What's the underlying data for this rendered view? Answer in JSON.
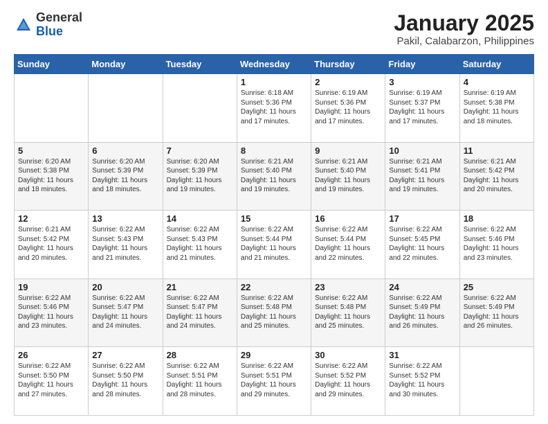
{
  "header": {
    "logo_general": "General",
    "logo_blue": "Blue",
    "title": "January 2025",
    "subtitle": "Pakil, Calabarzon, Philippines"
  },
  "weekdays": [
    "Sunday",
    "Monday",
    "Tuesday",
    "Wednesday",
    "Thursday",
    "Friday",
    "Saturday"
  ],
  "weeks": [
    [
      {
        "day": "",
        "info": ""
      },
      {
        "day": "",
        "info": ""
      },
      {
        "day": "",
        "info": ""
      },
      {
        "day": "1",
        "info": "Sunrise: 6:18 AM\nSunset: 5:36 PM\nDaylight: 11 hours\nand 17 minutes."
      },
      {
        "day": "2",
        "info": "Sunrise: 6:19 AM\nSunset: 5:36 PM\nDaylight: 11 hours\nand 17 minutes."
      },
      {
        "day": "3",
        "info": "Sunrise: 6:19 AM\nSunset: 5:37 PM\nDaylight: 11 hours\nand 17 minutes."
      },
      {
        "day": "4",
        "info": "Sunrise: 6:19 AM\nSunset: 5:38 PM\nDaylight: 11 hours\nand 18 minutes."
      }
    ],
    [
      {
        "day": "5",
        "info": "Sunrise: 6:20 AM\nSunset: 5:38 PM\nDaylight: 11 hours\nand 18 minutes."
      },
      {
        "day": "6",
        "info": "Sunrise: 6:20 AM\nSunset: 5:39 PM\nDaylight: 11 hours\nand 18 minutes."
      },
      {
        "day": "7",
        "info": "Sunrise: 6:20 AM\nSunset: 5:39 PM\nDaylight: 11 hours\nand 19 minutes."
      },
      {
        "day": "8",
        "info": "Sunrise: 6:21 AM\nSunset: 5:40 PM\nDaylight: 11 hours\nand 19 minutes."
      },
      {
        "day": "9",
        "info": "Sunrise: 6:21 AM\nSunset: 5:40 PM\nDaylight: 11 hours\nand 19 minutes."
      },
      {
        "day": "10",
        "info": "Sunrise: 6:21 AM\nSunset: 5:41 PM\nDaylight: 11 hours\nand 19 minutes."
      },
      {
        "day": "11",
        "info": "Sunrise: 6:21 AM\nSunset: 5:42 PM\nDaylight: 11 hours\nand 20 minutes."
      }
    ],
    [
      {
        "day": "12",
        "info": "Sunrise: 6:21 AM\nSunset: 5:42 PM\nDaylight: 11 hours\nand 20 minutes."
      },
      {
        "day": "13",
        "info": "Sunrise: 6:22 AM\nSunset: 5:43 PM\nDaylight: 11 hours\nand 21 minutes."
      },
      {
        "day": "14",
        "info": "Sunrise: 6:22 AM\nSunset: 5:43 PM\nDaylight: 11 hours\nand 21 minutes."
      },
      {
        "day": "15",
        "info": "Sunrise: 6:22 AM\nSunset: 5:44 PM\nDaylight: 11 hours\nand 21 minutes."
      },
      {
        "day": "16",
        "info": "Sunrise: 6:22 AM\nSunset: 5:44 PM\nDaylight: 11 hours\nand 22 minutes."
      },
      {
        "day": "17",
        "info": "Sunrise: 6:22 AM\nSunset: 5:45 PM\nDaylight: 11 hours\nand 22 minutes."
      },
      {
        "day": "18",
        "info": "Sunrise: 6:22 AM\nSunset: 5:46 PM\nDaylight: 11 hours\nand 23 minutes."
      }
    ],
    [
      {
        "day": "19",
        "info": "Sunrise: 6:22 AM\nSunset: 5:46 PM\nDaylight: 11 hours\nand 23 minutes."
      },
      {
        "day": "20",
        "info": "Sunrise: 6:22 AM\nSunset: 5:47 PM\nDaylight: 11 hours\nand 24 minutes."
      },
      {
        "day": "21",
        "info": "Sunrise: 6:22 AM\nSunset: 5:47 PM\nDaylight: 11 hours\nand 24 minutes."
      },
      {
        "day": "22",
        "info": "Sunrise: 6:22 AM\nSunset: 5:48 PM\nDaylight: 11 hours\nand 25 minutes."
      },
      {
        "day": "23",
        "info": "Sunrise: 6:22 AM\nSunset: 5:48 PM\nDaylight: 11 hours\nand 25 minutes."
      },
      {
        "day": "24",
        "info": "Sunrise: 6:22 AM\nSunset: 5:49 PM\nDaylight: 11 hours\nand 26 minutes."
      },
      {
        "day": "25",
        "info": "Sunrise: 6:22 AM\nSunset: 5:49 PM\nDaylight: 11 hours\nand 26 minutes."
      }
    ],
    [
      {
        "day": "26",
        "info": "Sunrise: 6:22 AM\nSunset: 5:50 PM\nDaylight: 11 hours\nand 27 minutes."
      },
      {
        "day": "27",
        "info": "Sunrise: 6:22 AM\nSunset: 5:50 PM\nDaylight: 11 hours\nand 28 minutes."
      },
      {
        "day": "28",
        "info": "Sunrise: 6:22 AM\nSunset: 5:51 PM\nDaylight: 11 hours\nand 28 minutes."
      },
      {
        "day": "29",
        "info": "Sunrise: 6:22 AM\nSunset: 5:51 PM\nDaylight: 11 hours\nand 29 minutes."
      },
      {
        "day": "30",
        "info": "Sunrise: 6:22 AM\nSunset: 5:52 PM\nDaylight: 11 hours\nand 29 minutes."
      },
      {
        "day": "31",
        "info": "Sunrise: 6:22 AM\nSunset: 5:52 PM\nDaylight: 11 hours\nand 30 minutes."
      },
      {
        "day": "",
        "info": ""
      }
    ]
  ]
}
